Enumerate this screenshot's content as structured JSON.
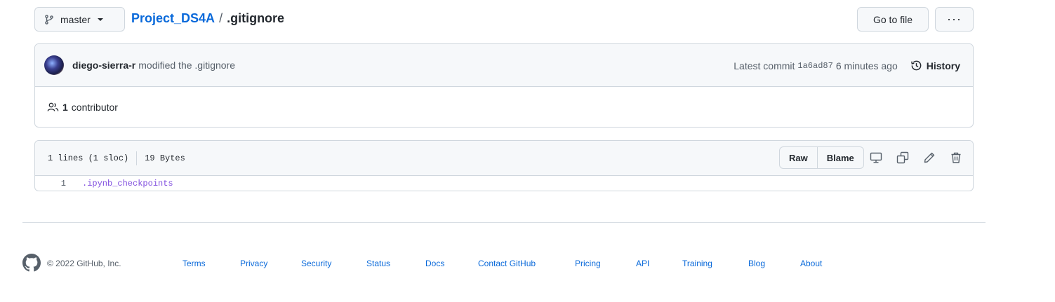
{
  "branch": {
    "label": "master"
  },
  "breadcrumb": {
    "repo": "Project_DS4A",
    "separator": "/",
    "file": ".gitignore"
  },
  "actions": {
    "go_to_file": "Go to file",
    "more": "···"
  },
  "commit": {
    "author": "diego-sierra-r",
    "message": "modified the .gitignore",
    "latest_label": "Latest commit",
    "sha": "1a6ad87",
    "time": "6 minutes ago",
    "history_label": "History"
  },
  "contributors": {
    "count": "1",
    "label": "contributor"
  },
  "file": {
    "lines_info": "1 lines (1 sloc)",
    "size": "19 Bytes",
    "raw_label": "Raw",
    "blame_label": "Blame",
    "code_lines": [
      {
        "number": "1",
        "text": ".ipynb_checkpoints"
      }
    ]
  },
  "footer": {
    "copyright": "© 2022 GitHub, Inc.",
    "links": [
      "Terms",
      "Privacy",
      "Security",
      "Status",
      "Docs",
      "Contact GitHub",
      "Pricing",
      "API",
      "Training",
      "Blog",
      "About"
    ]
  },
  "colors": {
    "link": "#0969da",
    "code": "#8250df",
    "border": "#d0d7de",
    "header_bg": "#f6f8fa"
  }
}
